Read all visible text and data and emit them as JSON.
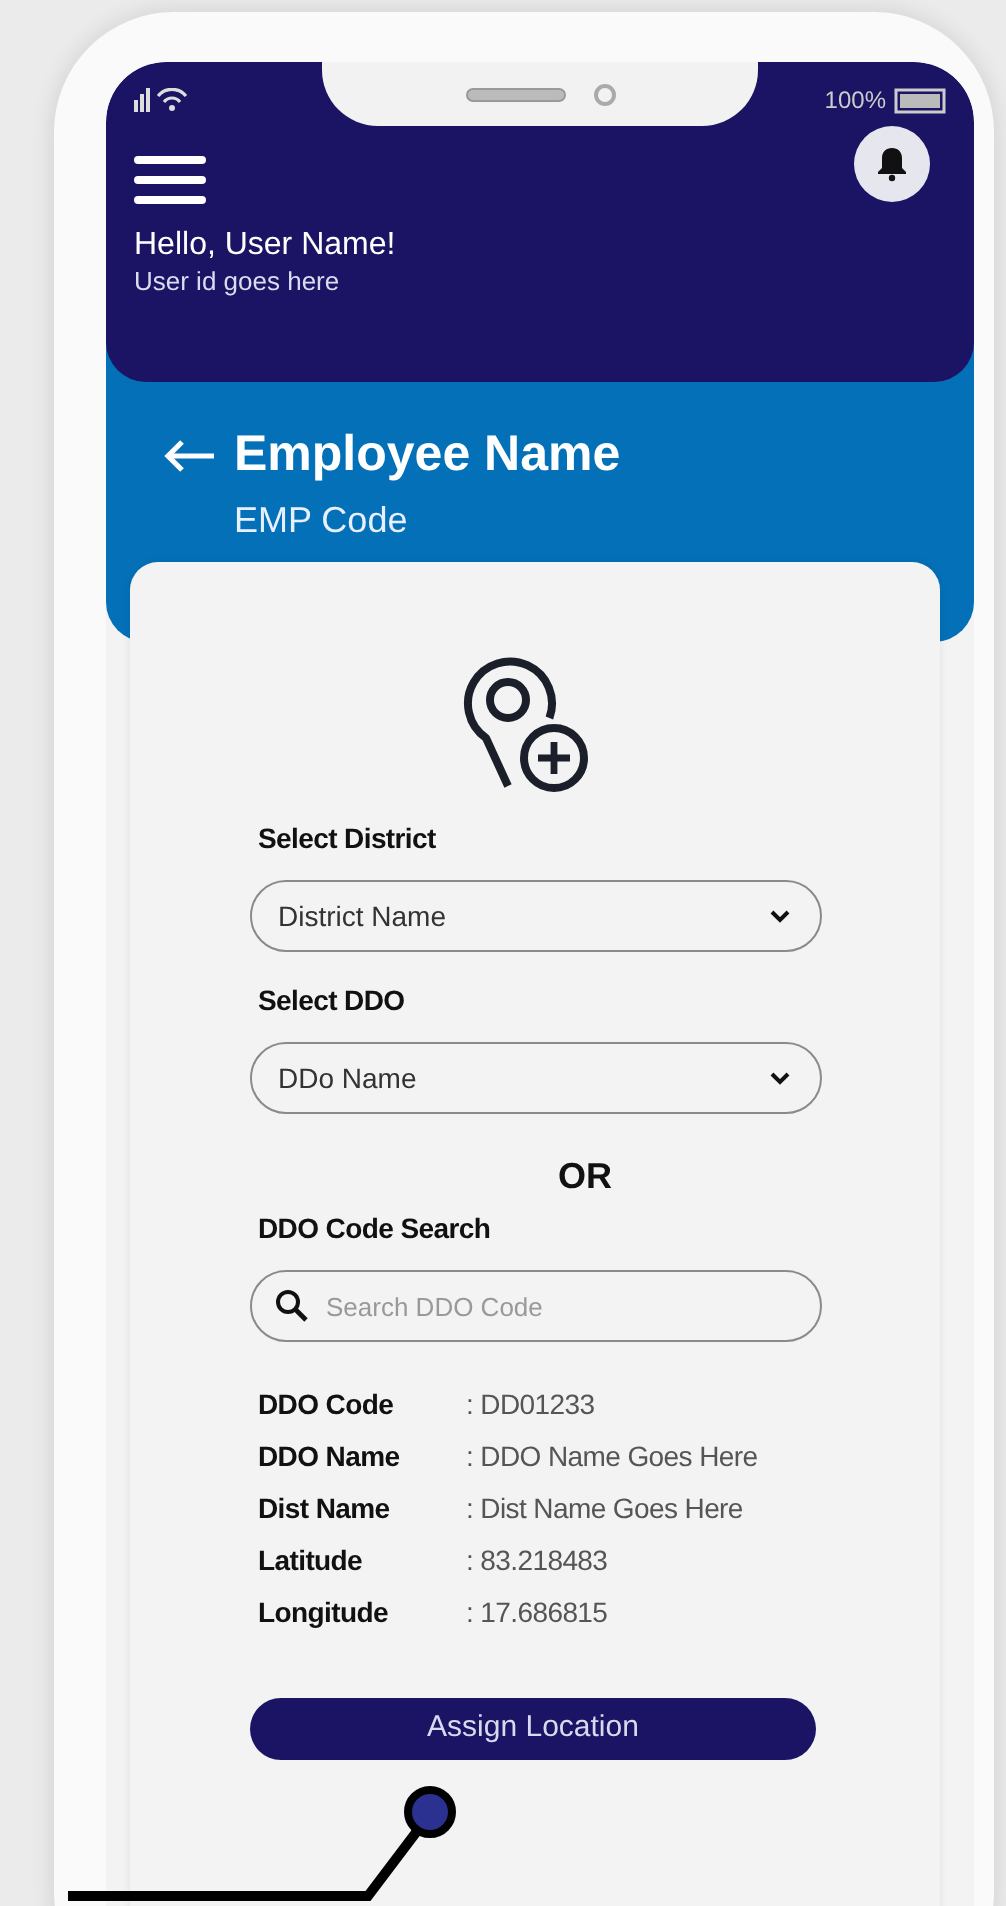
{
  "status_bar": {
    "battery": "100%"
  },
  "header": {
    "greeting": "Hello, User Name!",
    "user_id": "User id goes here"
  },
  "title_bar": {
    "title": "Employee Name",
    "subtitle": "EMP Code"
  },
  "form": {
    "sections": [
      {
        "kind": "select",
        "label": "Select District",
        "placeholder": "District Name"
      },
      {
        "kind": "select",
        "label": "Select DDO",
        "placeholder": "DDo Name"
      },
      {
        "kind": "separator",
        "text": "OR"
      },
      {
        "kind": "search",
        "label": "DDO Code Search",
        "placeholder": "Search DDO Code"
      }
    ]
  },
  "details": [
    {
      "label": "DDO Code",
      "value": ": DD01233"
    },
    {
      "label": "DDO Name",
      "value": ": DDO Name Goes Here"
    },
    {
      "label": "Dist Name",
      "value": ": Dist Name Goes Here"
    },
    {
      "label": "Latitude",
      "value": ": 83.218483"
    },
    {
      "label": "Longitude",
      "value": ": 17.686815"
    }
  ],
  "button": "Assign Location"
}
